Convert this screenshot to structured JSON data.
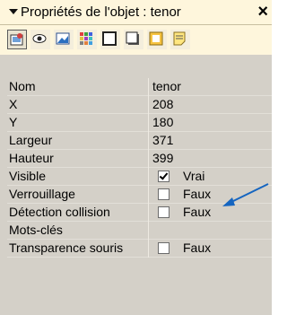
{
  "panel": {
    "title": "Propriétés de l'objet : tenor",
    "close_label": "×"
  },
  "toolbar": {
    "buttons": [
      {
        "icon": "properties-icon",
        "active": true
      },
      {
        "icon": "eye-icon"
      },
      {
        "icon": "image-icon"
      },
      {
        "icon": "grid-icon"
      },
      {
        "icon": "frame-icon"
      },
      {
        "icon": "shadow-box-icon"
      },
      {
        "icon": "yellow-box-icon"
      },
      {
        "icon": "note-icon"
      }
    ]
  },
  "properties": {
    "rows": [
      {
        "name": "Nom",
        "value": "tenor"
      },
      {
        "name": "X",
        "value": "208"
      },
      {
        "name": "Y",
        "value": "180"
      },
      {
        "name": "Largeur",
        "value": "371"
      },
      {
        "name": "Hauteur",
        "value": "399"
      },
      {
        "name": "Visible",
        "value": "Vrai",
        "checked": true
      },
      {
        "name": "Verrouillage",
        "value": "Faux",
        "checked": false
      },
      {
        "name": "Détection collision",
        "value": "Faux",
        "checked": false
      },
      {
        "name": "Mots-clés",
        "value": ""
      },
      {
        "name": "Transparence souris",
        "value": "Faux",
        "checked": false
      }
    ]
  },
  "colors": {
    "panel_bg": "#d4d0c8",
    "header_bg": "#fef6dc",
    "arrow": "#1565c0"
  }
}
